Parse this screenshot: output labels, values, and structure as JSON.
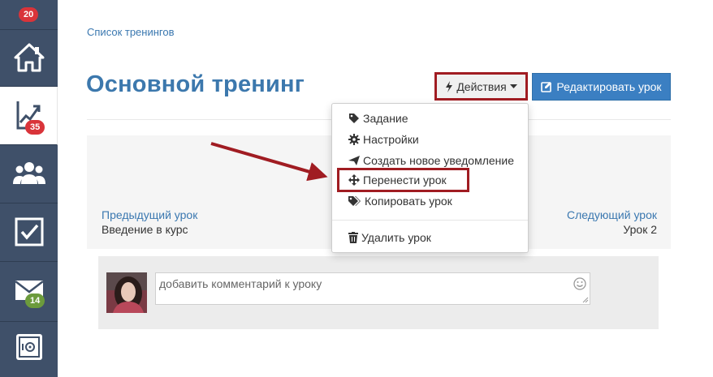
{
  "sidebar": {
    "top_badge": "20",
    "trainings_badge": "35",
    "messages_badge": "14"
  },
  "breadcrumb": "Список тренингов",
  "title": "Основной тренинг",
  "actions_button": "Действия",
  "edit_button": "Редактировать урок",
  "dropdown": {
    "items": [
      "Задание",
      "Настройки",
      "Создать новое уведомление",
      "Перенести урок",
      "Копировать урок"
    ],
    "delete": "Удалить урок"
  },
  "lesson_nav": {
    "prev_label": "Предыдущий урок",
    "prev_title": "Введение в курс",
    "next_label": "Следующий урок",
    "next_title": "Урок 2"
  },
  "comment": {
    "placeholder": "добавить комментарий к уроку"
  }
}
